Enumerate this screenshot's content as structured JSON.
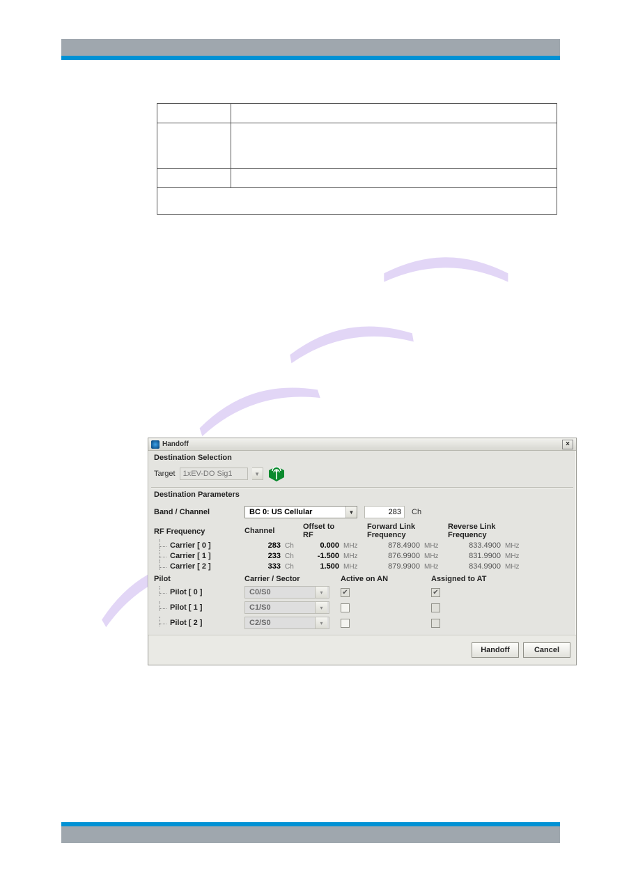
{
  "dialog": {
    "title": "Handoff",
    "close": "×",
    "destination_selection": {
      "section": "Destination Selection",
      "target_label": "Target",
      "target_value": "1xEV-DO Sig1"
    },
    "destination_parameters": {
      "section": "Destination Parameters",
      "band_channel_label": "Band / Channel",
      "band_select": "BC 0: US Cellular",
      "main_channel": "283",
      "main_channel_unit": "Ch",
      "rf_frequency_label": "RF Frequency",
      "columns": {
        "channel": "Channel",
        "offset": "Offset to RF",
        "fwd": "Forward Link Frequency",
        "rev": "Reverse Link Frequency"
      },
      "carriers": [
        {
          "label": "Carrier [ 0 ]",
          "channel": "283",
          "ch_unit": "Ch",
          "offset": "0.000",
          "off_unit": "MHz",
          "fwd": "878.4900",
          "fwd_unit": "MHz",
          "rev": "833.4900",
          "rev_unit": "MHz"
        },
        {
          "label": "Carrier [ 1 ]",
          "channel": "233",
          "ch_unit": "Ch",
          "offset": "-1.500",
          "off_unit": "MHz",
          "fwd": "876.9900",
          "fwd_unit": "MHz",
          "rev": "831.9900",
          "rev_unit": "MHz"
        },
        {
          "label": "Carrier [ 2 ]",
          "channel": "333",
          "ch_unit": "Ch",
          "offset": "1.500",
          "off_unit": "MHz",
          "fwd": "879.9900",
          "fwd_unit": "MHz",
          "rev": "834.9900",
          "rev_unit": "MHz"
        }
      ],
      "pilot_label": "Pilot",
      "pilot_columns": {
        "cs": "Carrier / Sector",
        "active": "Active on AN",
        "assigned": "Assigned to AT"
      },
      "pilots": [
        {
          "label": "Pilot [ 0 ]",
          "cs": "C0/S0",
          "active": true,
          "assigned": true
        },
        {
          "label": "Pilot [ 1 ]",
          "cs": "C1/S0",
          "active": false,
          "assigned": false
        },
        {
          "label": "Pilot [ 2 ]",
          "cs": "C2/S0",
          "active": false,
          "assigned": false
        }
      ]
    },
    "buttons": {
      "handoff": "Handoff",
      "cancel": "Cancel"
    }
  }
}
